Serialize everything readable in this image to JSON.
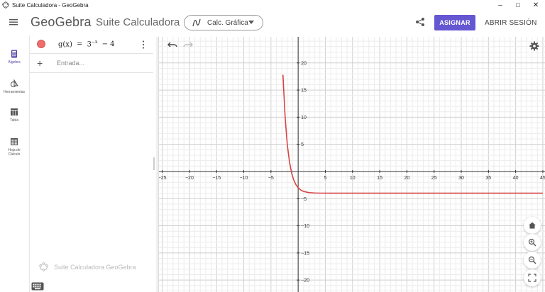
{
  "window": {
    "title": "Suite Calculadora - GeoGebra",
    "controls": [
      "–",
      "□",
      "✕"
    ]
  },
  "header": {
    "brand": "GeoGebra",
    "app_name": "Suite Calculadora",
    "app_switch_label": "Calc. Gráfica",
    "assign_label": "ASIGNAR",
    "signin_label": "ABRIR SESIÓN",
    "accent_color": "#6557d2"
  },
  "rail": {
    "items": [
      {
        "label": "Álgebra",
        "icon": "calculator-icon"
      },
      {
        "label": "Herramientas",
        "icon": "tools-icon"
      },
      {
        "label": "Tabla",
        "icon": "table-icon"
      },
      {
        "label": "Hoja de Cálculo",
        "icon": "spreadsheet-icon"
      }
    ]
  },
  "algebra": {
    "formula_lhs": "g(x)",
    "formula_eq": "=",
    "formula_base": "3",
    "formula_exp": "−x",
    "formula_rest": "− 4",
    "input_placeholder": "Entrada...",
    "watermark": "Suite Calculadora GeoGebra",
    "object_color": "#ee6e6e"
  },
  "chart_data": {
    "type": "line",
    "function": "3^(-x) - 4",
    "series": [
      {
        "name": "",
        "color": "#d84343",
        "x": [
          -2.8,
          -2.4,
          -2,
          -1.6,
          -1.2,
          -0.8,
          -0.4,
          0,
          0.5,
          1,
          2,
          3,
          4,
          6,
          10,
          20,
          45
        ],
        "y": [
          17.8,
          10.0,
          5.0,
          1.8,
          -0.3,
          -1.6,
          -2.45,
          -3.0,
          -3.42,
          -3.67,
          -3.89,
          -3.96,
          -3.99,
          -4.0,
          -4.0,
          -4.0,
          -4.0
        ]
      }
    ],
    "xlim": [
      -25.6,
      45.4
    ],
    "ylim": [
      -22.2,
      24.8
    ],
    "x_ticks": [
      -25,
      -20,
      -15,
      -10,
      -5,
      5,
      10,
      15,
      20,
      25,
      30,
      35,
      40,
      45
    ],
    "y_ticks": [
      20,
      15,
      10,
      5,
      -5,
      -10,
      -15,
      -20
    ],
    "minor_grid_step": 1,
    "major_grid_step": 5,
    "grid": true
  }
}
